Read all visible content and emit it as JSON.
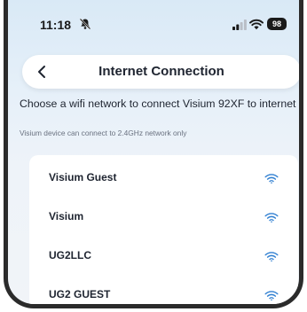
{
  "status_bar": {
    "time": "11:18",
    "silent_icon": "bell-slash-icon",
    "signal_icon": "cellular-signal-icon",
    "wifi_icon": "wifi-icon",
    "battery": "98"
  },
  "header": {
    "back_icon": "chevron-left-icon",
    "title": "Internet Connection"
  },
  "intro": {
    "text": "Choose a wifi network to connect Visium 92XF to internet",
    "subtext": "Visium device can connect to 2.4GHz network only"
  },
  "networks": [
    {
      "name": "Visium Guest",
      "icon": "wifi-icon"
    },
    {
      "name": "Visium",
      "icon": "wifi-icon"
    },
    {
      "name": "UG2LLC",
      "icon": "wifi-icon"
    },
    {
      "name": "UG2 GUEST",
      "icon": "wifi-icon"
    }
  ],
  "colors": {
    "accent": "#2f7fd1",
    "text": "#1e2430",
    "background_top": "#d9e9f6"
  }
}
